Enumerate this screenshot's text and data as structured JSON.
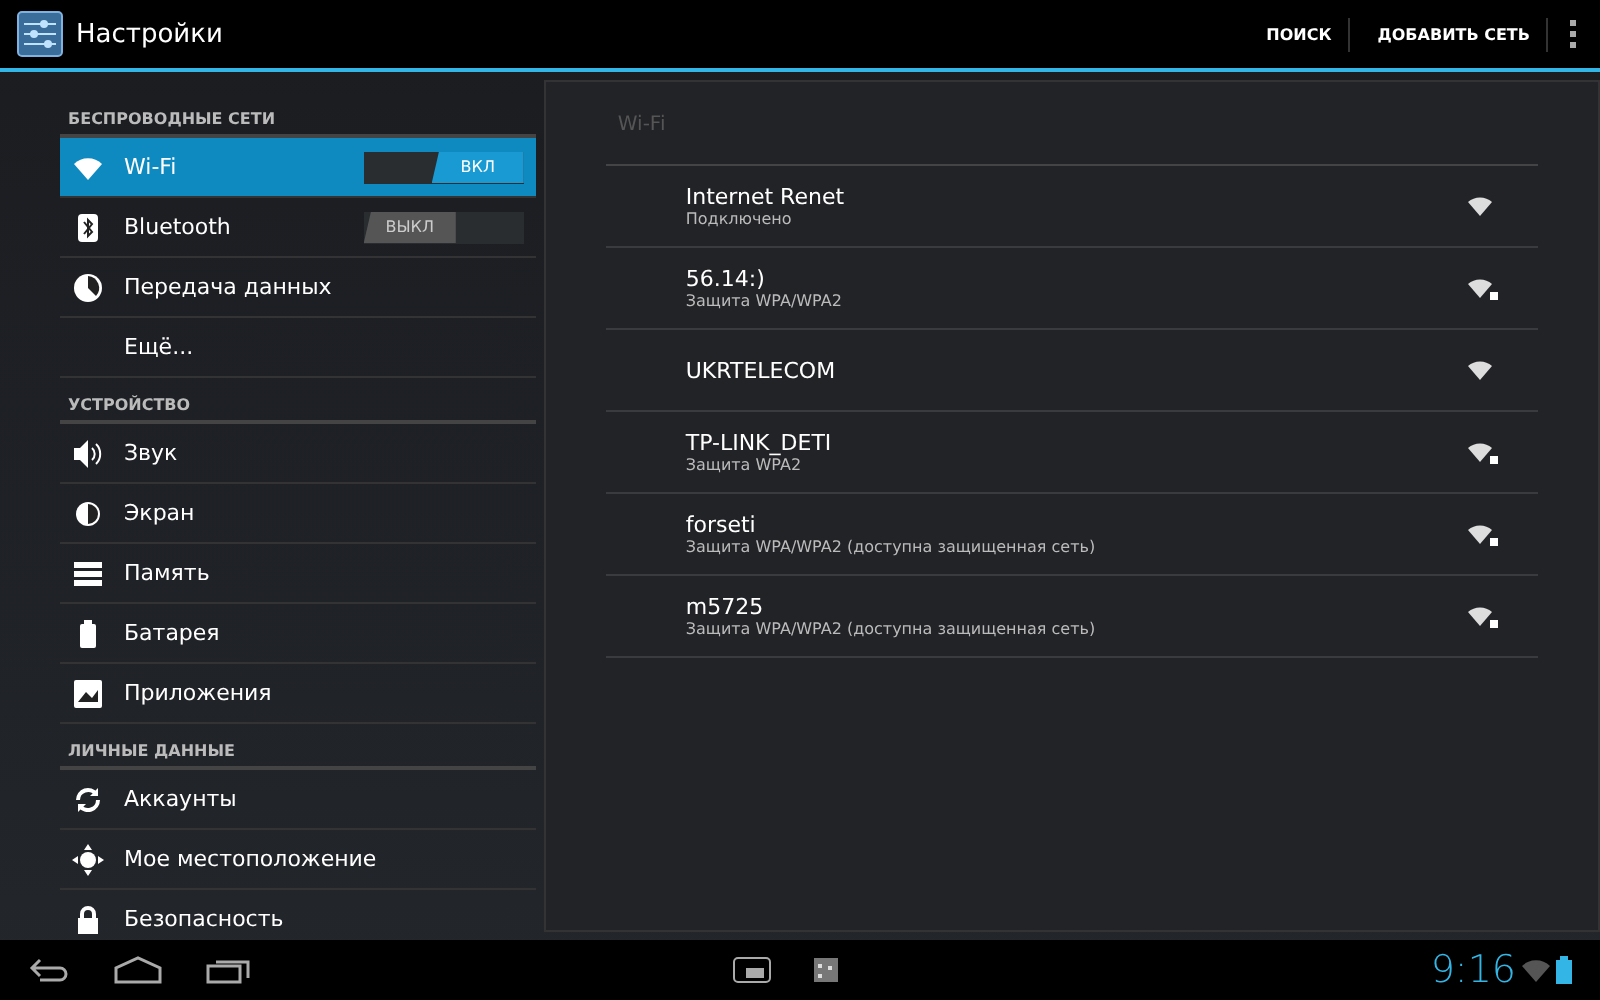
{
  "action_bar": {
    "title": "Настройки",
    "actions": [
      "ПОИСК",
      "ДОБАВИТЬ СЕТЬ"
    ]
  },
  "sidebar": {
    "sections": [
      {
        "header": "БЕСПРОВОДНЫЕ СЕТИ",
        "items": [
          {
            "label": "Wi-Fi",
            "selected": true,
            "kind": "toggle",
            "toggle": {
              "on": true,
              "label": "ВКЛ"
            }
          },
          {
            "label": "Bluetooth",
            "selected": false,
            "kind": "toggle",
            "toggle": {
              "on": false,
              "label": "ВЫКЛ"
            }
          },
          {
            "label": "Передача данных",
            "selected": false,
            "kind": "plain"
          },
          {
            "label": "Ещё...",
            "selected": false,
            "kind": "plain"
          }
        ]
      },
      {
        "header": "УСТРОЙСТВО",
        "items": [
          {
            "label": "Звук",
            "selected": false,
            "kind": "plain"
          },
          {
            "label": "Экран",
            "selected": false,
            "kind": "plain"
          },
          {
            "label": "Память",
            "selected": false,
            "kind": "plain"
          },
          {
            "label": "Батарея",
            "selected": false,
            "kind": "plain"
          },
          {
            "label": "Приложения",
            "selected": false,
            "kind": "plain"
          }
        ]
      },
      {
        "header": "ЛИЧНЫЕ ДАННЫЕ",
        "items": [
          {
            "label": "Аккаунты",
            "selected": false,
            "kind": "plain"
          },
          {
            "label": "Мое местоположение",
            "selected": false,
            "kind": "plain"
          },
          {
            "label": "Безопасность",
            "selected": false,
            "kind": "plain"
          }
        ]
      }
    ]
  },
  "panel": {
    "title": "Wi-Fi",
    "networks": [
      {
        "name": "Internet Renet",
        "status": "Подключено",
        "secured": false
      },
      {
        "name": "56.14:)",
        "status": "Защита WPA/WPA2",
        "secured": true
      },
      {
        "name": "UKRTELECOM",
        "secured": false
      },
      {
        "name": "TP-LINK_DETI",
        "status": "Защита WPA2",
        "secured": true
      },
      {
        "name": "forseti",
        "status": "Защита WPA/WPA2 (доступна защищенная сеть)",
        "secured": true
      },
      {
        "name": "m5725",
        "status": "Защита WPA/WPA2 (доступна защищенная сеть)",
        "secured": true
      }
    ]
  },
  "status_bar": {
    "time": "9:16"
  }
}
